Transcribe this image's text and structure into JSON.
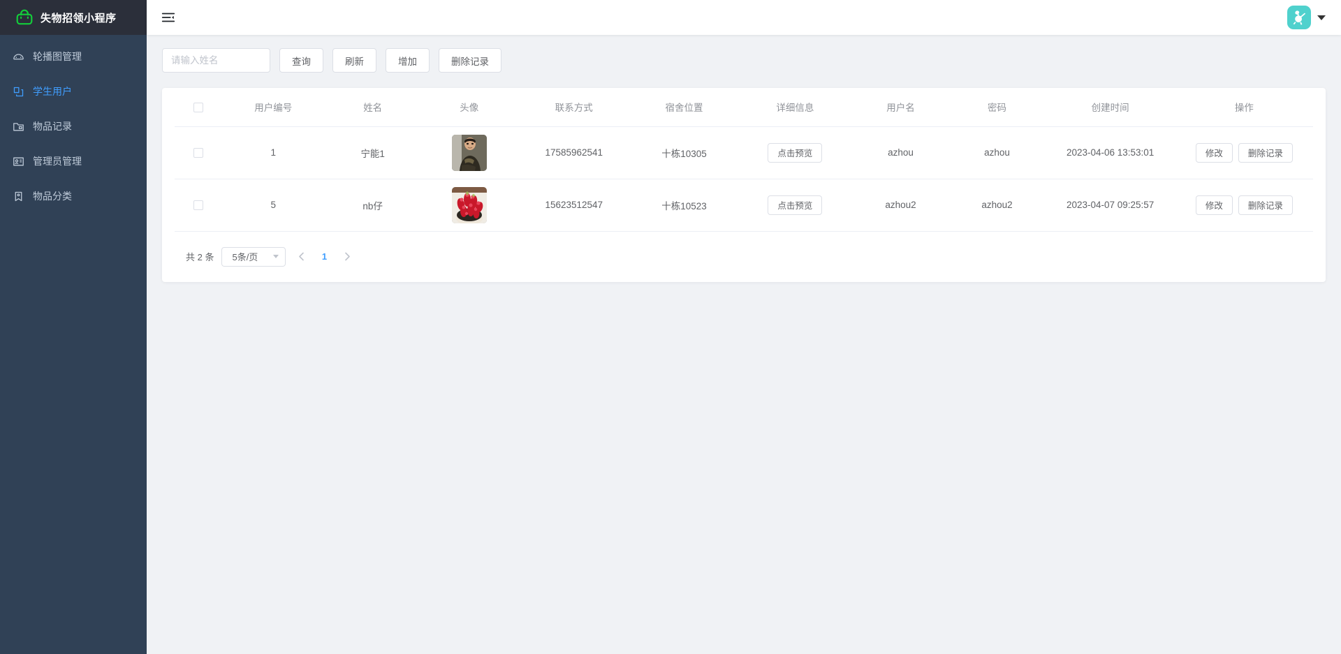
{
  "brand": {
    "title": "失物招领小程序",
    "logo_icon": "handbag-icon",
    "logo_color": "#13ce3a"
  },
  "sidebar": {
    "items": [
      {
        "label": "轮播图管理",
        "icon": "odometer-icon",
        "active": false
      },
      {
        "label": "学生用户",
        "icon": "document-copy-icon",
        "active": true
      },
      {
        "label": "物品记录",
        "icon": "folder-icon",
        "active": false
      },
      {
        "label": "管理员管理",
        "icon": "postcard-icon",
        "active": false
      },
      {
        "label": "物品分类",
        "icon": "price-tag-icon",
        "active": false
      }
    ],
    "bg_color": "#304156",
    "active_color": "#409eff"
  },
  "navbar": {
    "hamburger_icon": "fold-menu-icon",
    "avatar_icon": "user-avatar-icon",
    "avatar_bg": "#4fd1cd",
    "caret_icon": "caret-down-icon"
  },
  "toolbar": {
    "search_placeholder": "请输入姓名",
    "search_value": "",
    "query_label": "查询",
    "refresh_label": "刷新",
    "add_label": "增加",
    "delete_label": "删除记录"
  },
  "table": {
    "columns": [
      "",
      "用户编号",
      "姓名",
      "头像",
      "联系方式",
      "宿舍位置",
      "详细信息",
      "用户名",
      "密码",
      "创建时间",
      "操作"
    ],
    "preview_label": "点击预览",
    "edit_label": "修改",
    "row_delete_label": "删除记录",
    "rows": [
      {
        "id": "1",
        "name": "宁能1",
        "avatar": "person-photo",
        "phone": "17585962541",
        "dorm": "十栋10305",
        "username": "azhou",
        "password": "azhou",
        "created": "2023-04-06 13:53:01"
      },
      {
        "id": "5",
        "name": "nb仔",
        "avatar": "succulent-plant-photo",
        "phone": "15623512547",
        "dorm": "十栋10523",
        "username": "azhou2",
        "password": "azhou2",
        "created": "2023-04-07 09:25:57"
      }
    ]
  },
  "pagination": {
    "total_label": "共 2 条",
    "page_size_label": "5条/页",
    "prev_icon": "chevron-left-icon",
    "next_icon": "chevron-right-icon",
    "current_page": "1"
  }
}
